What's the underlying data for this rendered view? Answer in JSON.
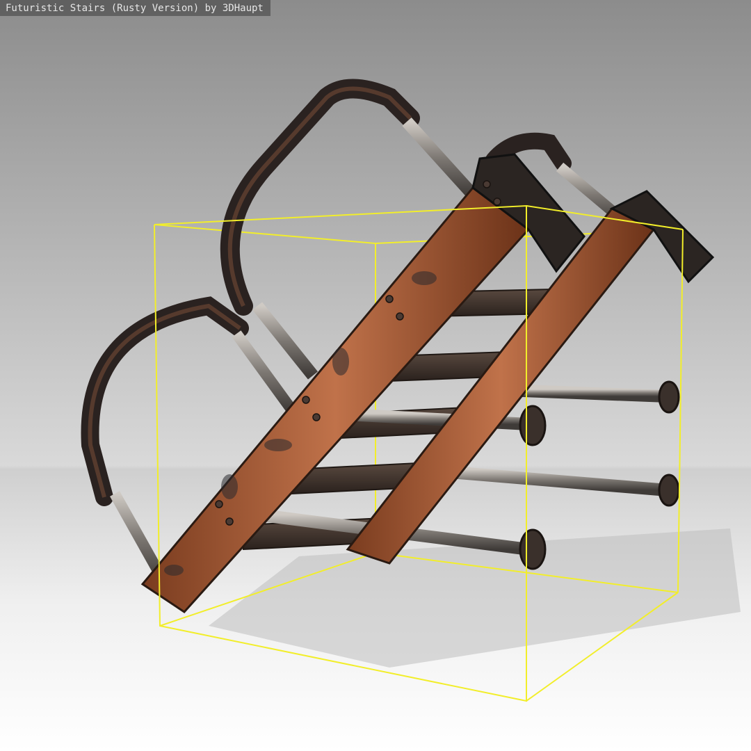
{
  "viewer": {
    "title": "Futuristic Stairs (Rusty Version) by 3DHaupt"
  },
  "scene": {
    "object": "futuristic-stairs-rusty",
    "selection_box_color": "#f2ee2a",
    "background_top": "#8c8c8c",
    "background_floor": "#ffffff",
    "rust_color": "#b8683f",
    "metal_color": "#8a8682"
  }
}
